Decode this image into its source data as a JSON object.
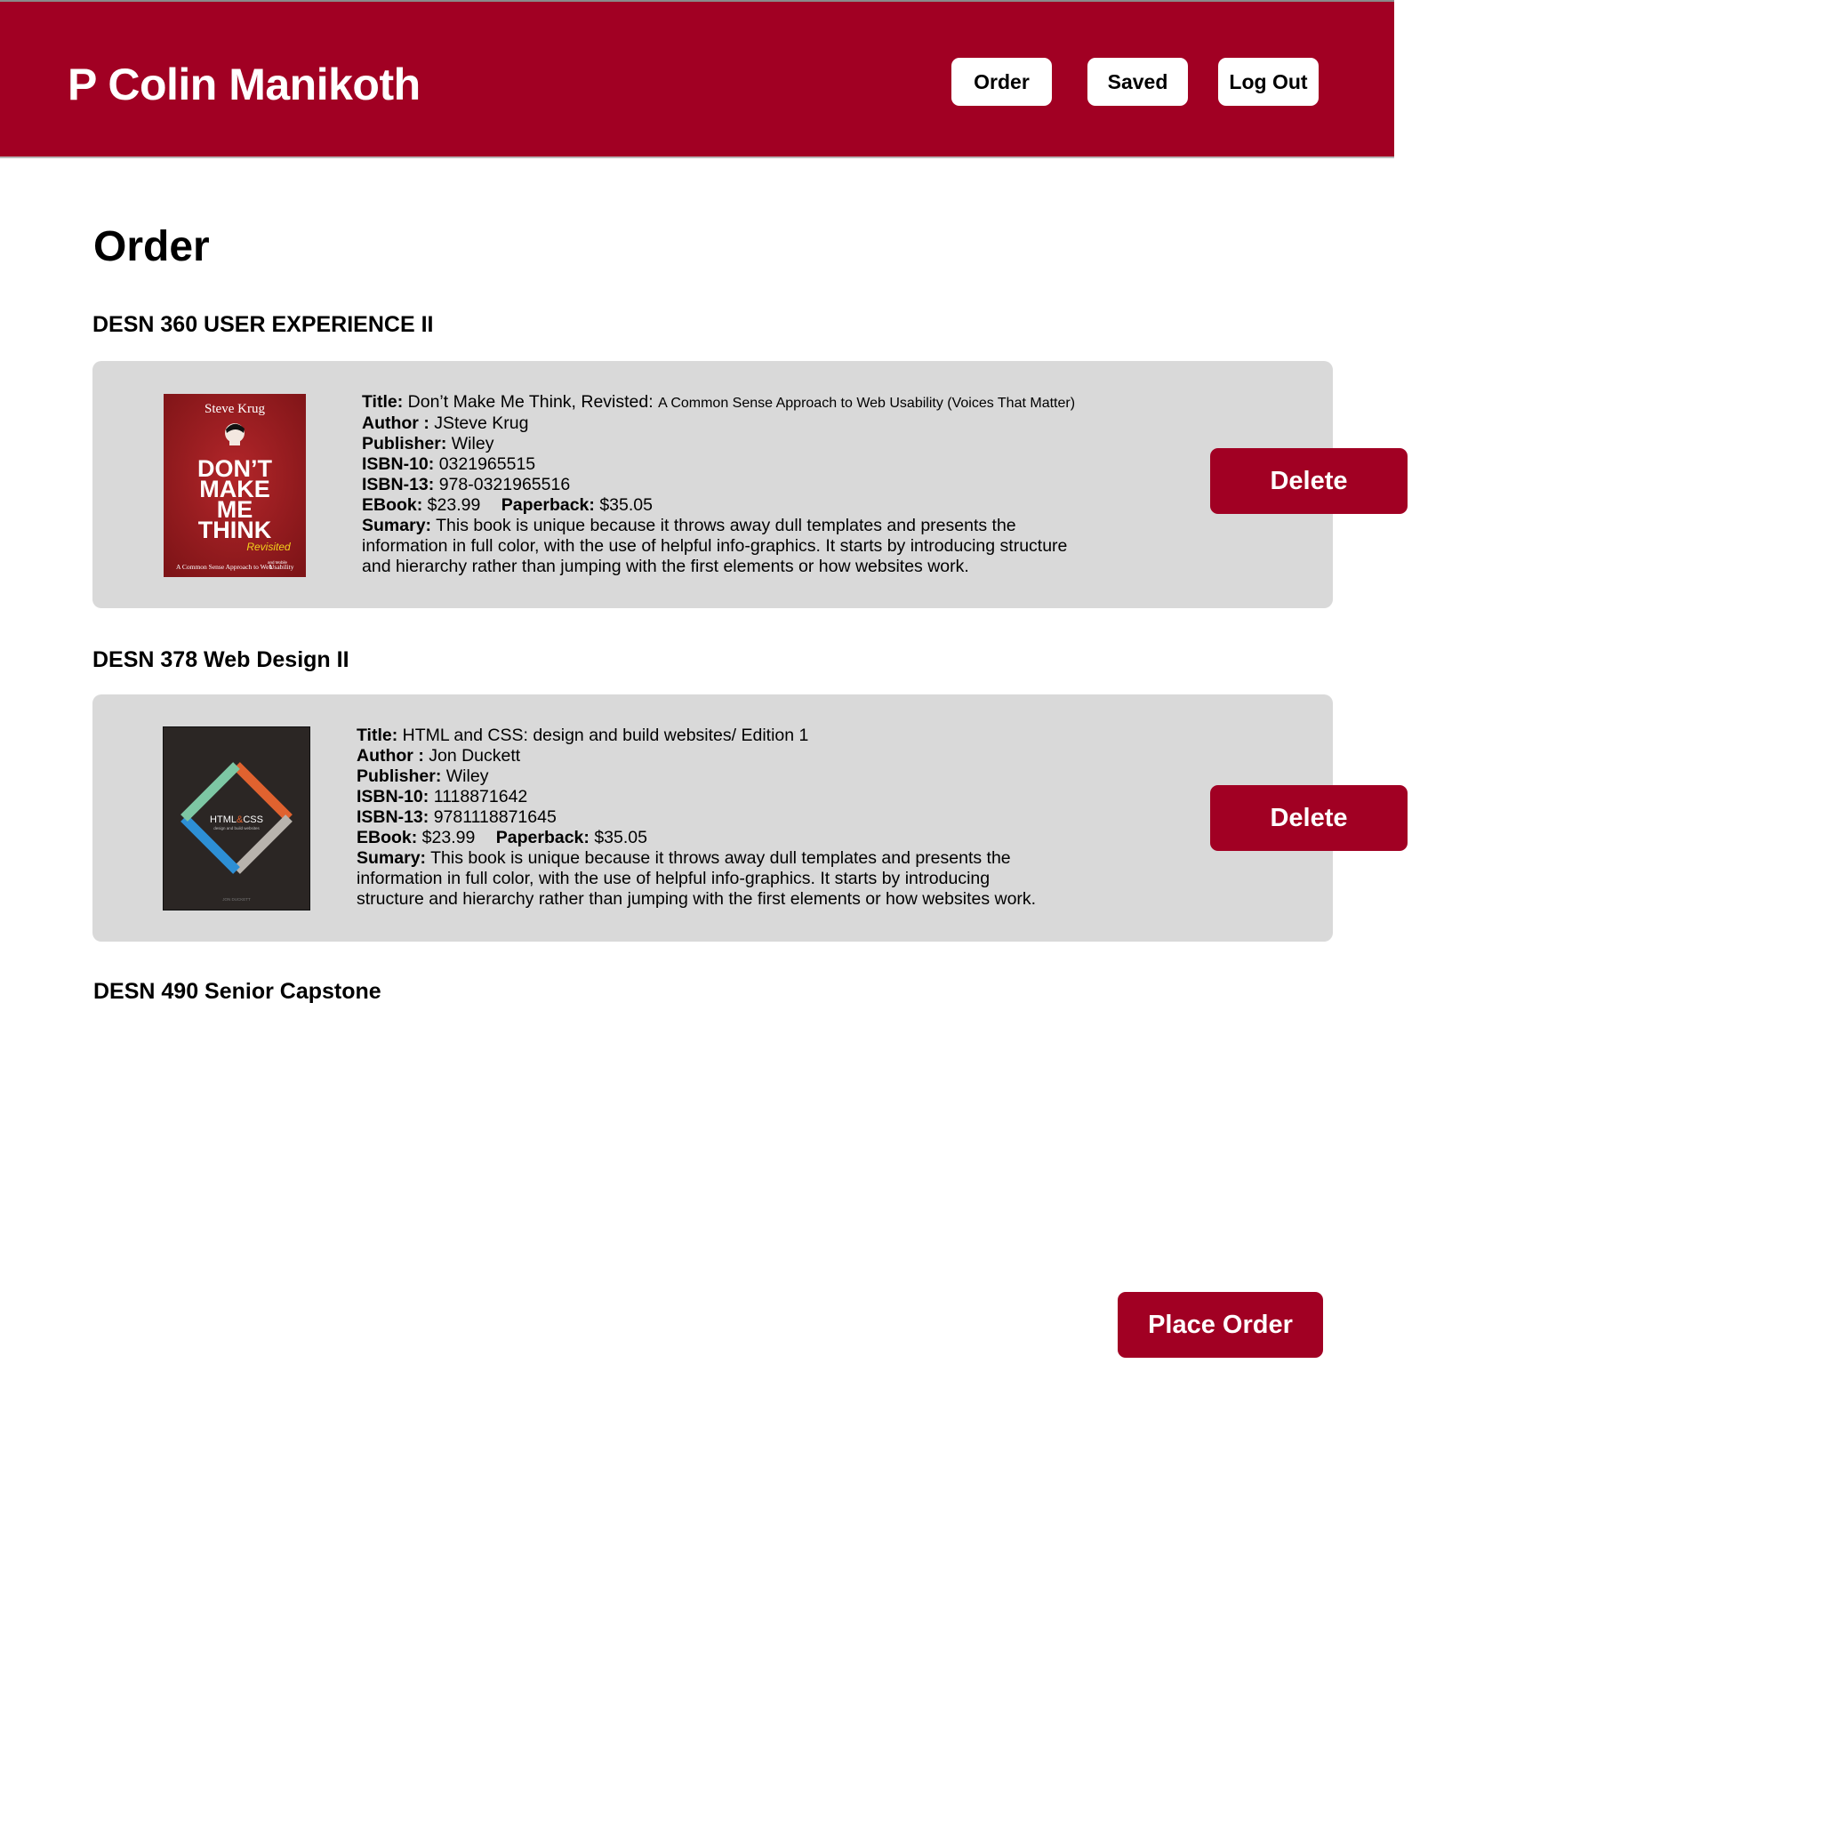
{
  "header": {
    "brand": "P Colin Manikoth",
    "nav": {
      "order": "Order",
      "saved": "Saved",
      "logout": "Log Out"
    }
  },
  "page_title": "Order",
  "courses": [
    {
      "title": "DESN 360 USER EXPERIENCE II",
      "book": {
        "cover": {
          "author": "Steve Krug",
          "lines": [
            "DON’T",
            "MAKE",
            "ME",
            "THINK"
          ],
          "revisited": "Revisited",
          "subtitle_pre": "A Common Sense Approach to Web",
          "subtitle_small": "and Mobile",
          "subtitle_post": "Usability"
        },
        "title_label": "Title:",
        "title_main": "Don’t Make Me Think, Revisted:",
        "title_sub": "A Common Sense Approach to Web Usability (Voices That Matter)",
        "author_label": "Author :",
        "author": "JSteve Krug",
        "publisher_label": "Publisher:",
        "publisher": "Wiley",
        "isbn10_label": "ISBN-10:",
        "isbn10": "0321965515",
        "isbn13_label": "ISBN-13:",
        "isbn13": "978-0321965516",
        "ebook_label": "EBook:",
        "ebook": "$23.99",
        "paperback_label": "Paperback:",
        "paperback": "$35.05",
        "summary_label": "Sumary:",
        "summary_lines": [
          "This book is unique because it throws away dull templates and presents the",
          "information in full color, with the use of helpful info-graphics. It starts by introducing structure",
          "and hierarchy rather than jumping with the first elements or how websites work."
        ],
        "delete_label": "Delete"
      }
    },
    {
      "title": "DESN 378 Web Design II",
      "book": {
        "cover": {
          "title_a": "HTML",
          "title_amp": "&",
          "title_b": "CSS",
          "tagline": "design and build websites",
          "author": "JON DUCKETT"
        },
        "title_label": "Title:",
        "title_main": "HTML and CSS: design and build websites/ Edition 1",
        "author_label": "Author :",
        "author": "Jon Duckett",
        "publisher_label": "Publisher:",
        "publisher": "Wiley",
        "isbn10_label": "ISBN-10:",
        "isbn10": "1118871642",
        "isbn13_label": "ISBN-13:",
        "isbn13": "9781118871645",
        "ebook_label": "EBook:",
        "ebook": "$23.99",
        "paperback_label": "Paperback:",
        "paperback": "$35.05",
        "summary_label": "Sumary:",
        "summary_lines": [
          "This book is unique because it throws away dull templates and presents the",
          "information in full color, with the use of helpful info-graphics. It starts by introducing",
          "structure and hierarchy rather than jumping with the first elements or how websites work."
        ],
        "delete_label": "Delete"
      }
    },
    {
      "title": "DESN 490 Senior Capstone"
    }
  ],
  "place_order_label": "Place Order",
  "colors": {
    "brand": "#a10023",
    "card": "#d9d9d9",
    "cover_red": "#9c1b1f",
    "cover_dark": "#2b2624"
  }
}
